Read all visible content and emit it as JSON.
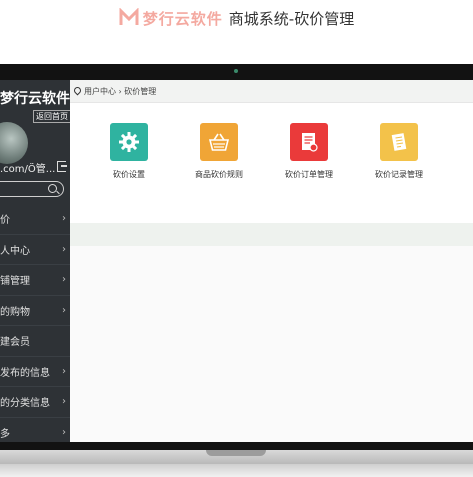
{
  "header": {
    "brand": "梦行云软件",
    "subtitle": "商城系统-砍价管理",
    "brand_color": "#f4a9a0",
    "logo_color": "#f4a9a0"
  },
  "sidebar": {
    "brand": "梦行云软件",
    "back_home": "返回首页",
    "user_name": ".com/Ö管...",
    "menu": [
      {
        "label": "价"
      },
      {
        "label": "人中心"
      },
      {
        "label": "铺管理"
      },
      {
        "label": "的购物"
      },
      {
        "label": "建会员"
      },
      {
        "label": "发布的信息"
      },
      {
        "label": "的分类信息"
      },
      {
        "label": "多"
      }
    ],
    "bg_color": "#2e3236"
  },
  "breadcrumb": {
    "text": "用户中心 › 砍价管理"
  },
  "tiles": [
    {
      "label": "砍价设置",
      "color": "#2fb3a0",
      "icon": "gear-icon"
    },
    {
      "label": "商品砍价规则",
      "color": "#f0a536",
      "icon": "basket-icon"
    },
    {
      "label": "砍价订单管理",
      "color": "#ea3a3a",
      "icon": "order-form-icon"
    },
    {
      "label": "砍价记录管理",
      "color": "#f3c24a",
      "icon": "record-document-icon"
    }
  ]
}
